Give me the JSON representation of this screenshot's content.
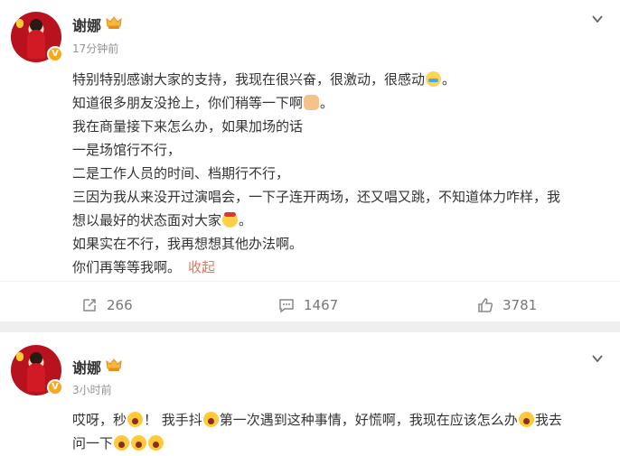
{
  "posts": [
    {
      "author": "谢娜",
      "time": "17分钟前",
      "lines": [
        "特别特别感谢大家的支持，我现在很兴奋，很激动，很感动",
        "知道很多朋友没抢上，你们稍等一下啊",
        "我在商量接下来怎么办，如果加场的话",
        "一是场馆行不行，",
        "二是工作人员的时间、档期行不行，",
        "三因为我从来没开过演唱会，一下子连开两场，还又唱又跳，不知道体力咋样，我",
        "想以最好的状态面对大家",
        "如果实在不行，我再想想其他办法啊。",
        "你们再等等我啊。"
      ],
      "line_endings": [
        "。",
        "。",
        "",
        "",
        "",
        "",
        "。",
        "",
        ""
      ],
      "collapse_label": "收起",
      "actions": {
        "repost": "266",
        "comment": "1467",
        "like": "3781"
      }
    },
    {
      "author": "谢娜",
      "time": "3小时前",
      "text_parts": [
        "哎呀，秒",
        "！ 我手抖",
        "第一次遇到这种事情，好慌啊，我现在应该怎么办",
        "我去",
        "问一下"
      ]
    }
  ],
  "icons": {
    "vip_badge": "vip-crown-icon",
    "verified": "verified-v-icon",
    "more": "chevron-down-icon",
    "repost": "repost-icon",
    "comment": "comment-icon",
    "like": "thumbs-up-icon"
  },
  "colors": {
    "link": "#eb7350",
    "timestamp": "#939393",
    "background": "#efefef"
  }
}
